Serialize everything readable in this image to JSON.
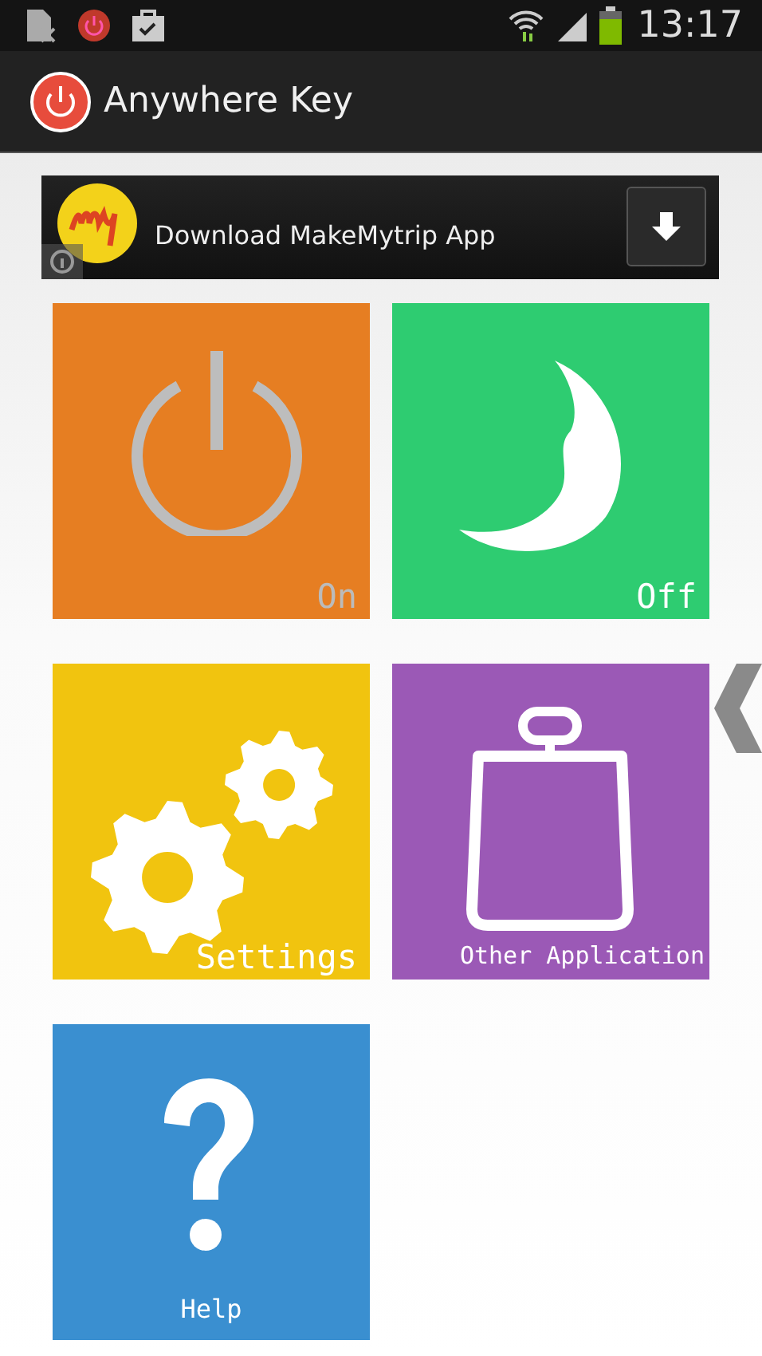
{
  "status_bar": {
    "time": "13:17"
  },
  "app_bar": {
    "title": "Anywhere Key"
  },
  "ad": {
    "title": "Download MakeMytrip App"
  },
  "tiles": [
    {
      "kind": "power",
      "label": "On",
      "color": "#e67e22"
    },
    {
      "kind": "moon",
      "label": "Off",
      "color": "#2ecc71"
    },
    {
      "kind": "gears",
      "label": "Settings",
      "color": "#f1c40f"
    },
    {
      "kind": "bag",
      "label": "Other Application",
      "color": "#9b59b6"
    },
    {
      "kind": "help",
      "label": "Help",
      "color": "#3a8fd0"
    }
  ]
}
